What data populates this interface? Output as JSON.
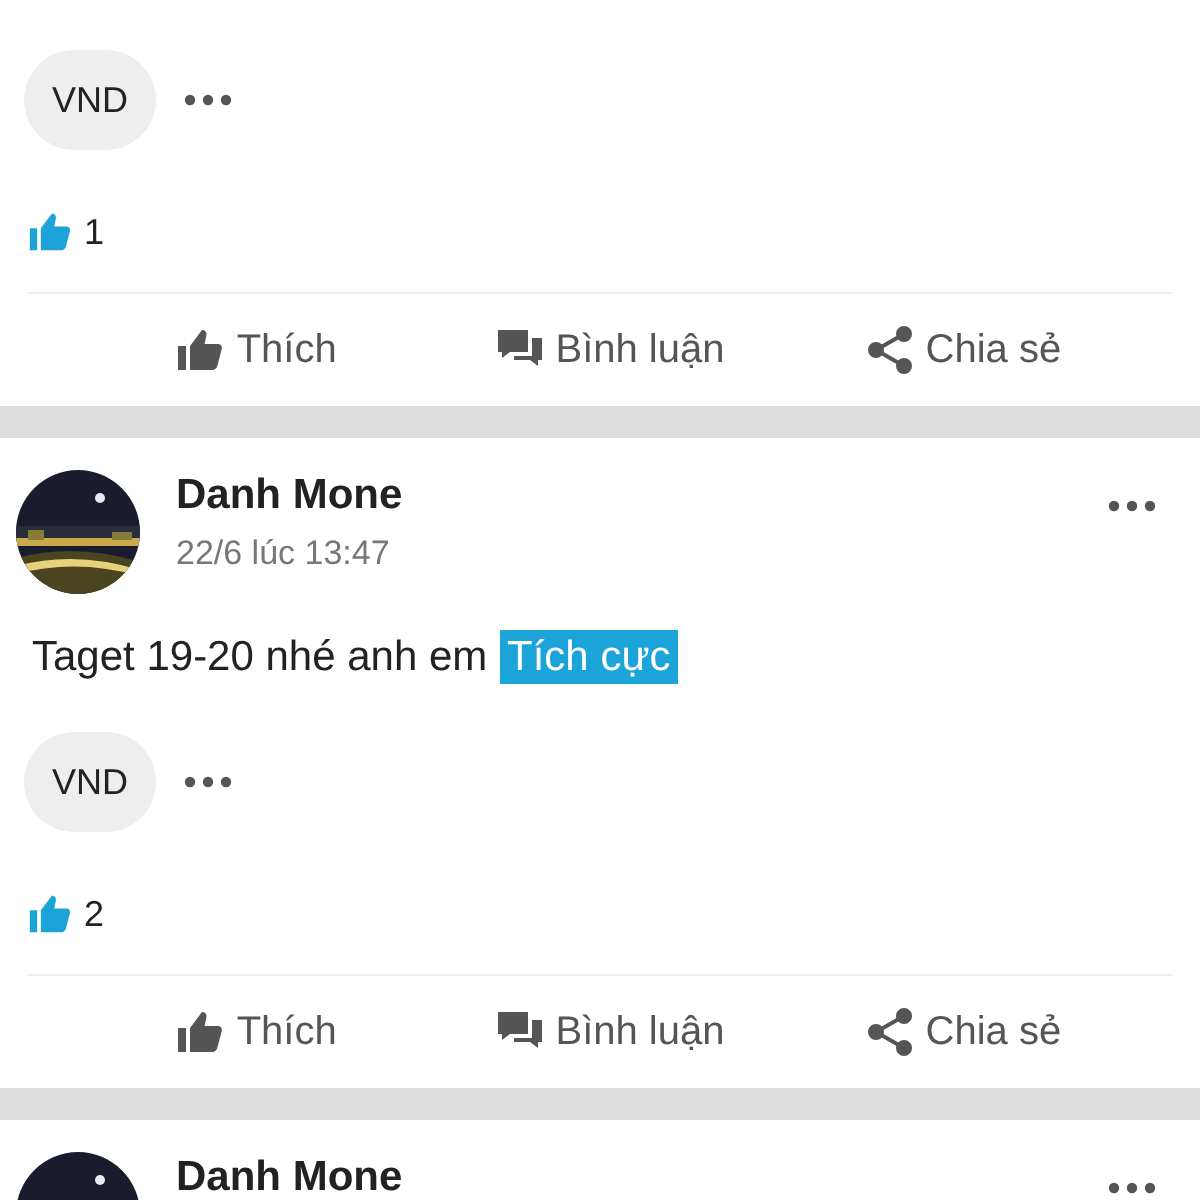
{
  "posts": [
    {
      "tags": [
        "VND"
      ],
      "likes": "1",
      "actions": [
        {
          "kind": "like",
          "label": "Thích"
        },
        {
          "kind": "comment",
          "label": "Bình luận"
        },
        {
          "kind": "share",
          "label": "Chia sẻ"
        }
      ]
    },
    {
      "author": "Danh Mone",
      "time": "22/6 lúc 13:47",
      "text": "Taget 19-20 nhé anh em",
      "sentiment": "Tích cực",
      "tags": [
        "VND"
      ],
      "likes": "2",
      "actions": [
        {
          "kind": "like",
          "label": "Thích"
        },
        {
          "kind": "comment",
          "label": "Bình luận"
        },
        {
          "kind": "share",
          "label": "Chia sẻ"
        }
      ]
    },
    {
      "author": "Danh Mone"
    }
  ]
}
